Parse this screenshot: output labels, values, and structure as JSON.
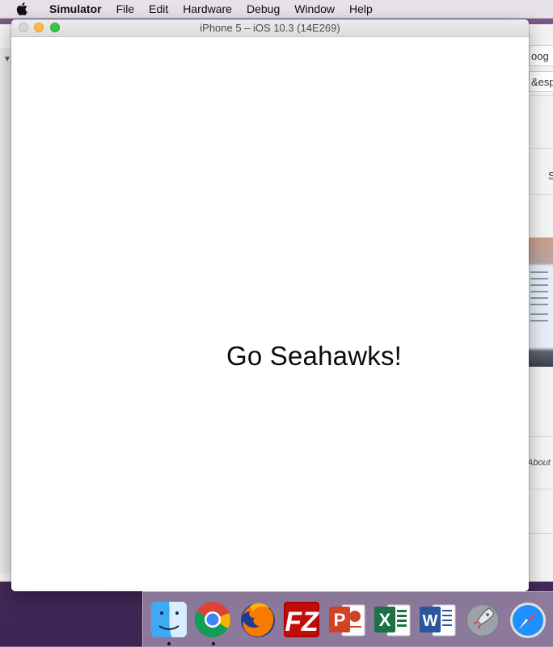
{
  "menubar": {
    "apple": "apple-icon",
    "items": [
      "Simulator",
      "File",
      "Edit",
      "Hardware",
      "Debug",
      "Window",
      "Help"
    ]
  },
  "background_window": {
    "field1_text": "oog",
    "field2_text": "&espv",
    "side_letter": "S",
    "about_text": "About"
  },
  "simulator": {
    "title": "iPhone 5 – iOS 10.3 (14E269)",
    "label_text": "Go Seahawks!"
  },
  "dock": {
    "apps": [
      "finder-icon",
      "chrome-icon",
      "firefox-icon",
      "filezilla-icon",
      "powerpoint-icon",
      "excel-icon",
      "word-icon",
      "launchpad-icon",
      "safari-icon"
    ],
    "running": [
      "finder-icon",
      "chrome-icon"
    ]
  },
  "colors": {
    "desktop": "#5e3a6d",
    "close_button": "#d6d6d6",
    "minimize_button": "#fdbc40",
    "zoom_button": "#33c748"
  }
}
